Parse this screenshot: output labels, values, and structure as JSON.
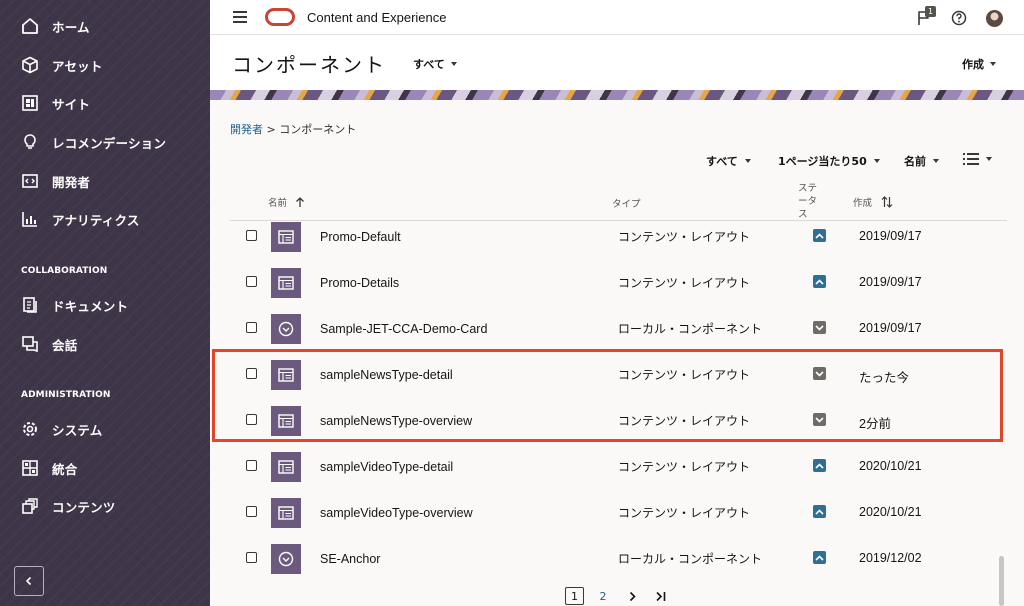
{
  "sidebar": {
    "items": [
      {
        "label": "ホーム",
        "icon": "home-icon"
      },
      {
        "label": "アセット",
        "icon": "cube-icon"
      },
      {
        "label": "サイト",
        "icon": "site-icon"
      },
      {
        "label": "レコメンデーション",
        "icon": "lightbulb-icon"
      },
      {
        "label": "開発者",
        "icon": "code-icon"
      },
      {
        "label": "アナリティクス",
        "icon": "chart-icon"
      }
    ],
    "collaboration_title": "COLLABORATION",
    "collaboration_items": [
      {
        "label": "ドキュメント",
        "icon": "documents-icon"
      },
      {
        "label": "会話",
        "icon": "conversation-icon"
      }
    ],
    "administration_title": "ADMINISTRATION",
    "administration_items": [
      {
        "label": "システム",
        "icon": "gear-icon"
      },
      {
        "label": "統合",
        "icon": "integration-icon"
      },
      {
        "label": "コンテンツ",
        "icon": "content-icon"
      }
    ]
  },
  "topbar": {
    "app_title": "Content and Experience",
    "notification_count": "1"
  },
  "header": {
    "title": "コンポーネント",
    "filter": "すべて",
    "create": "作成"
  },
  "breadcrumb": {
    "parent": "開発者",
    "separator": ">",
    "current": "コンポーネント"
  },
  "toolbar": {
    "filter": "すべて",
    "per_page": "1ページ当たり50",
    "sort": "名前"
  },
  "table": {
    "headers": {
      "name": "名前",
      "type": "タイプ",
      "status": "ステータス",
      "created": "作成"
    },
    "rows": [
      {
        "name": "Promo-Default",
        "type": "コンテンツ・レイアウト",
        "status": "published",
        "date": "2019/09/17",
        "thumb": "layout-icon"
      },
      {
        "name": "Promo-Details",
        "type": "コンテンツ・レイアウト",
        "status": "published",
        "date": "2019/09/17",
        "thumb": "layout-icon"
      },
      {
        "name": "Sample-JET-CCA-Demo-Card",
        "type": "ローカル・コンポーネント",
        "status": "draft",
        "date": "2019/09/17",
        "thumb": "component-icon"
      },
      {
        "name": "sampleNewsType-detail",
        "type": "コンテンツ・レイアウト",
        "status": "draft",
        "date": "たった今",
        "thumb": "layout-icon"
      },
      {
        "name": "sampleNewsType-overview",
        "type": "コンテンツ・レイアウト",
        "status": "draft",
        "date": "2分前",
        "thumb": "layout-icon"
      },
      {
        "name": "sampleVideoType-detail",
        "type": "コンテンツ・レイアウト",
        "status": "published",
        "date": "2020/10/21",
        "thumb": "layout-icon"
      },
      {
        "name": "sampleVideoType-overview",
        "type": "コンテンツ・レイアウト",
        "status": "published",
        "date": "2020/10/21",
        "thumb": "layout-icon"
      },
      {
        "name": "SE-Anchor",
        "type": "ローカル・コンポーネント",
        "status": "published",
        "date": "2019/12/02",
        "thumb": "component-icon"
      }
    ]
  },
  "pagination": {
    "page1": "1",
    "page2": "2"
  },
  "colors": {
    "sidebar": "#3f3548",
    "published": "#2f6f93",
    "draft": "#6f6b67",
    "highlight": "#e3452a",
    "thumb": "#6b5a7e"
  }
}
